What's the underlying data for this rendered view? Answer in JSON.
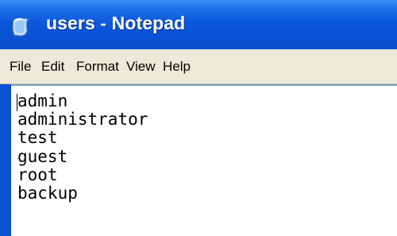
{
  "window": {
    "title": "users - Notepad",
    "icon": "notepad-icon"
  },
  "menu": {
    "items": [
      "File",
      "Edit",
      "Format",
      "View",
      "Help"
    ]
  },
  "editor": {
    "lines": [
      "admin",
      "administrator",
      "test",
      "guest",
      "root",
      "backup"
    ],
    "content": "admin\nadministrator\ntest\nguest\nroot\nbackup"
  },
  "colors": {
    "titlebar": "#0a52d4",
    "menubar": "#ece9d8",
    "editor_background": "#ffffff"
  }
}
